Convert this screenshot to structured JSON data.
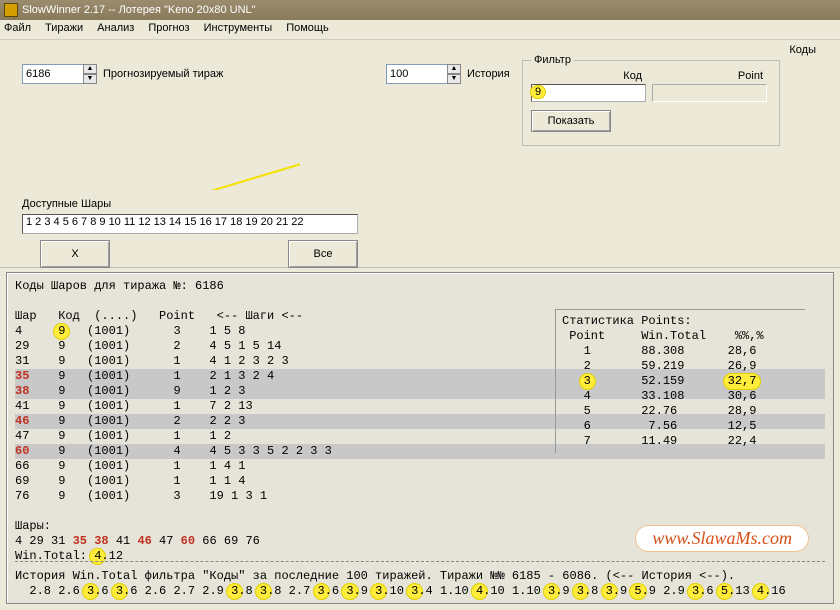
{
  "title": "SlowWinner 2.17 -- Лотерея \"Keno 20x80 UNL\"",
  "menu": [
    "Файл",
    "Тиражи",
    "Анализ",
    "Прогноз",
    "Инструменты",
    "Помощь"
  ],
  "kody_label": "Коды",
  "predicted": {
    "value": "6186",
    "label": "Прогнозируемый тираж"
  },
  "history": {
    "value": "100",
    "label": "История"
  },
  "filter": {
    "legend": "Фильтр",
    "kod_label": "Код",
    "kod_value": "9",
    "point_label": "Point",
    "point_value": "",
    "show_btn": "Показать"
  },
  "balls": {
    "label": "Доступные Шары",
    "value": "1 2 3 4 5 6 7 8 9 10 11 12 13 14 15 16 17 18 19 20 21 22",
    "x_btn": "X",
    "all_btn": "Все"
  },
  "report": {
    "header": "Коды Шаров для тиража №: 6186",
    "cols": "Шар   Код  (....)   Point   <-- Шаги <--",
    "rows": [
      {
        "ball": "4",
        "kod": "9",
        "mask": "(1001)",
        "point": "3",
        "steps": "1 5 8",
        "hl": false,
        "red": false,
        "hlkod": true
      },
      {
        "ball": "29",
        "kod": "9",
        "mask": "(1001)",
        "point": "2",
        "steps": "4 5 1 5 14",
        "hl": false,
        "red": false
      },
      {
        "ball": "31",
        "kod": "9",
        "mask": "(1001)",
        "point": "1",
        "steps": "4 1 2 3 2 3",
        "hl": false,
        "red": false
      },
      {
        "ball": "35",
        "kod": "9",
        "mask": "(1001)",
        "point": "1",
        "steps": "2 1 3 2 4",
        "hl": true,
        "red": true
      },
      {
        "ball": "38",
        "kod": "9",
        "mask": "(1001)",
        "point": "9",
        "steps": "1 2 3",
        "hl": true,
        "red": true
      },
      {
        "ball": "41",
        "kod": "9",
        "mask": "(1001)",
        "point": "1",
        "steps": "7 2 13",
        "hl": false,
        "red": false
      },
      {
        "ball": "46",
        "kod": "9",
        "mask": "(1001)",
        "point": "2",
        "steps": "2 2 3",
        "hl": true,
        "red": true
      },
      {
        "ball": "47",
        "kod": "9",
        "mask": "(1001)",
        "point": "1",
        "steps": "1 2",
        "hl": false,
        "red": false
      },
      {
        "ball": "60",
        "kod": "9",
        "mask": "(1001)",
        "point": "4",
        "steps": "4 5 3 3 5 2 2 3 3",
        "hl": true,
        "red": true
      },
      {
        "ball": "66",
        "kod": "9",
        "mask": "(1001)",
        "point": "1",
        "steps": "1 4 1",
        "hl": false,
        "red": false
      },
      {
        "ball": "69",
        "kod": "9",
        "mask": "(1001)",
        "point": "1",
        "steps": "1 1 4",
        "hl": false,
        "red": false
      },
      {
        "ball": "76",
        "kod": "9",
        "mask": "(1001)",
        "point": "3",
        "steps": "19 1 3 1",
        "hl": false,
        "red": false
      }
    ],
    "shary_label": "Шары:",
    "shary_line": {
      "plain": [
        "4 29 31 ",
        "35",
        " ",
        "38",
        " 41 ",
        "46",
        " 47 ",
        "60",
        " 66 69 76"
      ]
    },
    "wintotal_label": "Win.Total: ",
    "wintotal_hi": "4",
    "wintotal_rest": ".12",
    "history_hdr": "История Win.Total фильтра \"Коды\" за последние 100 тиражей. Тиражи №№ 6185 - 6086. (<-- История <--).",
    "history_vals": [
      "2.8",
      "2.6",
      "3.6",
      "3.6",
      "2.6",
      "2.7",
      "2.9",
      "3.8",
      "3.8",
      "2.7",
      "3.6",
      "3.9",
      "3.10",
      "3.4",
      "1.10",
      "4.10",
      "1.10",
      "3.9",
      "3.8",
      "3.9",
      "5.9",
      "2.9",
      "3.6",
      "5.13",
      "4.16"
    ]
  },
  "stats": {
    "title": "Статистика Points:",
    "cols": " Point     Win.Total    %%,%",
    "rows": [
      {
        "p": "1",
        "wt": "88.308",
        "pc": "28,6",
        "hl": false
      },
      {
        "p": "2",
        "wt": "59.219",
        "pc": "26,9",
        "hl": false
      },
      {
        "p": "3",
        "wt": "52.159",
        "pc": "32,7",
        "hl": true
      },
      {
        "p": "4",
        "wt": "33.108",
        "pc": "30,6",
        "hl": false
      },
      {
        "p": "5",
        "wt": "22.76",
        "pc": "28,9",
        "hl": false
      },
      {
        "p": "6",
        "wt": " 7.56",
        "pc": "12,5",
        "hl": false
      },
      {
        "p": "7",
        "wt": "11.49",
        "pc": "22,4",
        "hl": false
      }
    ]
  },
  "website": "www.SlawaMs.com"
}
